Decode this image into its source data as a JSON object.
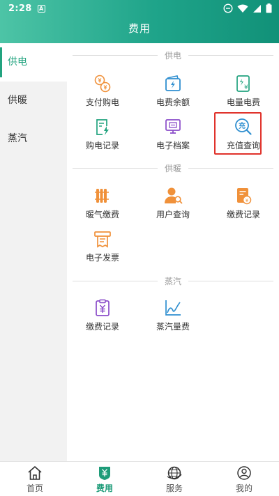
{
  "status_bar": {
    "time": "2:28",
    "badge": "A"
  },
  "header": {
    "title": "费用"
  },
  "sidebar": {
    "items": [
      {
        "label": "供电",
        "active": true
      },
      {
        "label": "供暖",
        "active": false
      },
      {
        "label": "蒸汽",
        "active": false
      }
    ]
  },
  "sections": {
    "power": {
      "title": "供电",
      "items": [
        {
          "label": "支付购电",
          "icon": "coin-exchange-icon"
        },
        {
          "label": "电费余额",
          "icon": "electric-wallet-icon"
        },
        {
          "label": "电量电费",
          "icon": "electric-bill-icon"
        },
        {
          "label": "购电记录",
          "icon": "purchase-record-icon"
        },
        {
          "label": "电子档案",
          "icon": "monitor-archive-icon"
        },
        {
          "label": "充值查询",
          "icon": "recharge-search-icon",
          "highlighted": true
        }
      ]
    },
    "heating": {
      "title": "供暖",
      "items": [
        {
          "label": "暖气缴费",
          "icon": "radiator-icon"
        },
        {
          "label": "用户查询",
          "icon": "user-search-icon"
        },
        {
          "label": "缴费记录",
          "icon": "payment-record-icon"
        },
        {
          "label": "电子发票",
          "icon": "receipt-icon"
        }
      ]
    },
    "steam": {
      "title": "蒸汽",
      "items": [
        {
          "label": "缴费记录",
          "icon": "clipboard-yuan-icon"
        },
        {
          "label": "蒸汽量费",
          "icon": "line-chart-icon"
        }
      ]
    }
  },
  "bottom_nav": {
    "items": [
      {
        "label": "首页",
        "icon": "home-icon",
        "active": false
      },
      {
        "label": "费用",
        "icon": "yuan-shield-icon",
        "active": true
      },
      {
        "label": "服务",
        "icon": "globe-icon",
        "active": false
      },
      {
        "label": "我的",
        "icon": "user-icon",
        "active": false
      }
    ]
  },
  "colors": {
    "header_start": "#4dc4a6",
    "header_end": "#119178",
    "accent_green": "#22a37f",
    "orange": "#f0913a",
    "blue": "#2f8fd0",
    "teal": "#22a37f",
    "purple": "#8a4cc9",
    "highlight_red": "#e0322b"
  }
}
